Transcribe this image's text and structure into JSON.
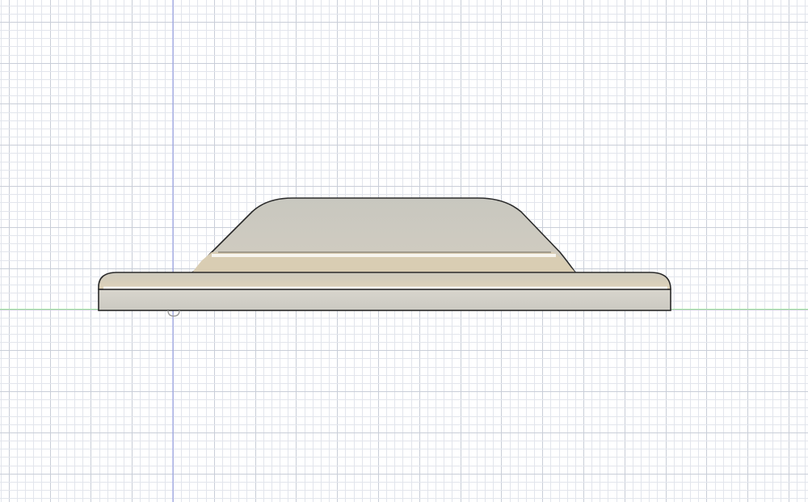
{
  "viewport": {
    "background": "#ffffff",
    "grid": true,
    "grid_minor_color": "#e2e5ec",
    "grid_major_color": "#c9ced8"
  },
  "axes": {
    "vertical_axis_color": "#8f98e6",
    "horizontal_axis_color": "#9fe39f"
  },
  "model": {
    "view": "side",
    "outline_color": "#2a2a2a",
    "body_color": "#c9c7bf",
    "base_top_color": "#d8cdb6",
    "highlight_color": "#f7f5ef"
  },
  "origin_marker": {
    "icon": "origin-icon"
  }
}
